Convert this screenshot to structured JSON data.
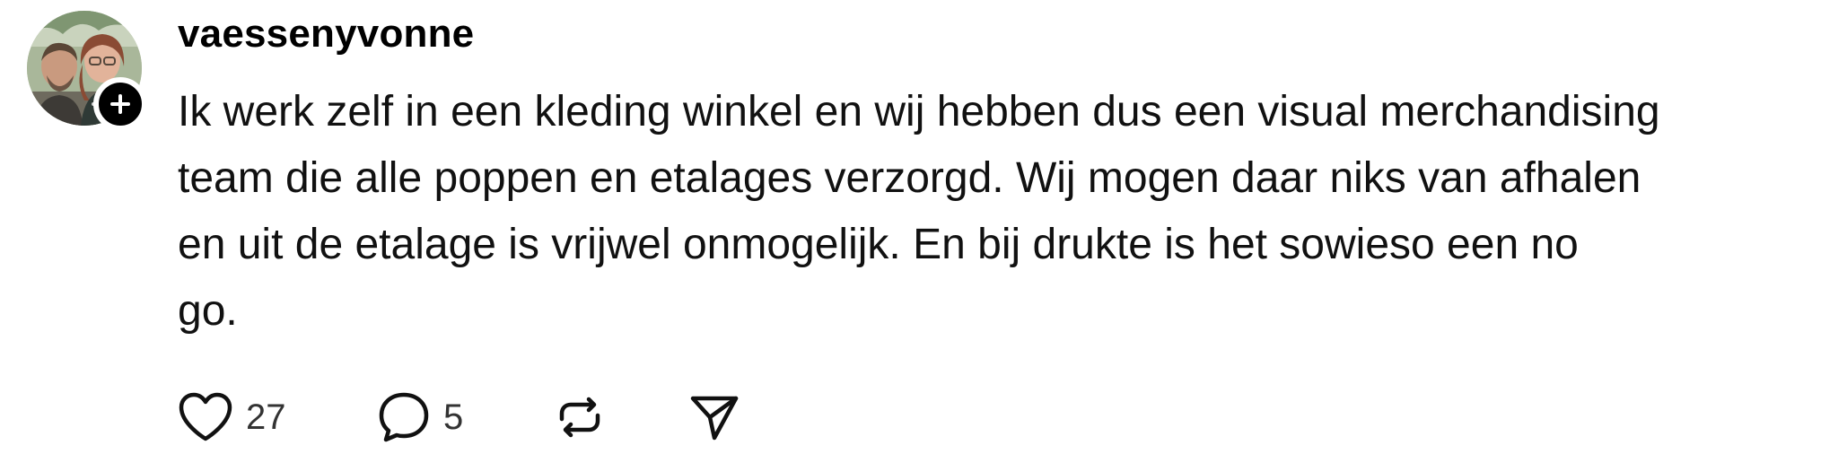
{
  "comment": {
    "username": "vaessenyvonne",
    "text_lines": [
      "Ik werk zelf in een kleding winkel en wij hebben dus een visual merchandising",
      "team die alle poppen en etalages verzorgd. Wij mogen daar niks van afhalen",
      "en uit de etalage is vrijwel onmogelijk. En bij drukte is het sowieso een no",
      "go."
    ]
  },
  "actions": {
    "like": {
      "icon": "heart-icon",
      "count": "27"
    },
    "reply": {
      "icon": "speech-bubble-icon",
      "count": "5"
    },
    "repost": {
      "icon": "repost-icon"
    },
    "share": {
      "icon": "send-icon"
    }
  },
  "colors": {
    "text": "#000000",
    "muted": "#333333",
    "follow_button": "#000000"
  }
}
